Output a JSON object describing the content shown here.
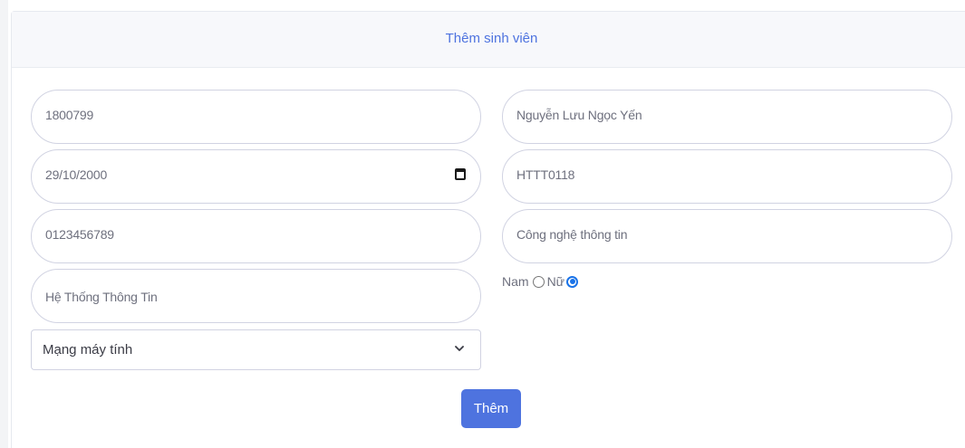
{
  "card": {
    "title": "Thêm sinh viên"
  },
  "form": {
    "student_id": "1800799",
    "birth_date": "29/10/2000",
    "phone": "0123456789",
    "department": "Hệ Thống Thông Tin",
    "full_name": "Nguyễn Lưu Ngọc Yến",
    "class_code": "HTTT0118",
    "faculty": "Công nghệ thông tin",
    "major_select": {
      "selected": "Mạng máy tính"
    },
    "gender": {
      "label_male": "Nam",
      "label_female": "Nữ",
      "selected": "Nữ"
    },
    "submit_label": "Thêm"
  },
  "colors": {
    "accent": "#4e73df",
    "radio_checked": "#1a73e8",
    "border": "#d1d3e2"
  },
  "icons": {
    "date": "calendar-icon",
    "select": "chevron-down-icon"
  }
}
